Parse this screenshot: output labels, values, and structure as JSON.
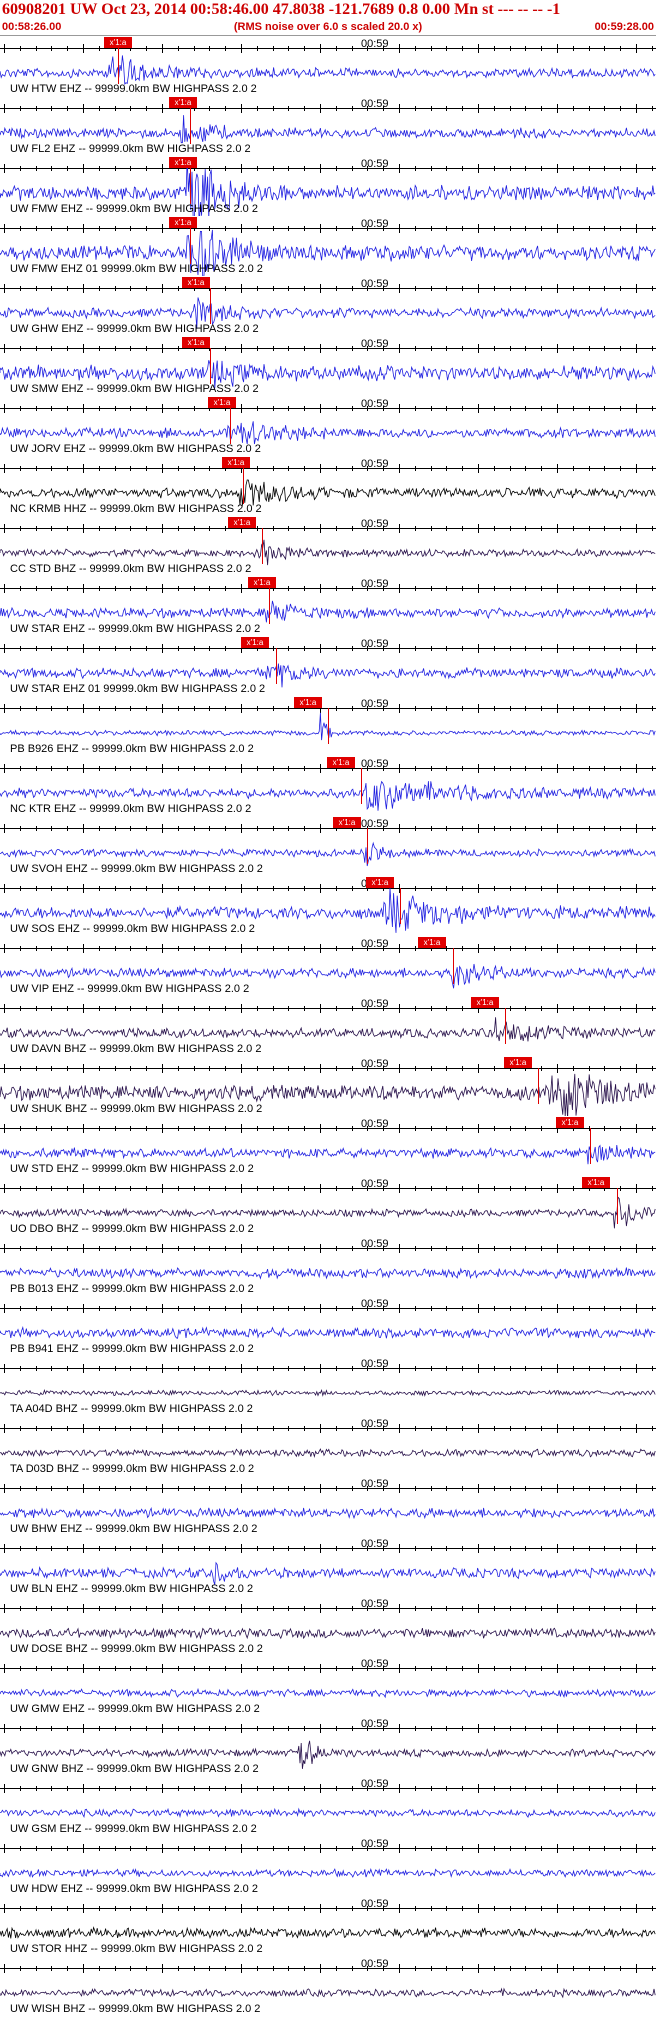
{
  "header": {
    "title": "60908201 UW Oct 23, 2014 00:58:46.00   47.8038 -121.7689  0.8 0.00 Mn st --- -- --  -1",
    "start_time": "00:58:26.00",
    "scale_note": "(RMS noise over 6.0 s scaled 20.0 x)",
    "end_time": "00:59:28.00"
  },
  "time_label": "00:59",
  "pick_label": "x'1:a",
  "colors": {
    "blue": "#1f1fe0",
    "black": "#000000",
    "navy": "#27104a",
    "pick": "#e00000",
    "title": "#cc0000"
  },
  "traces": [
    {
      "label": "UW HTW EHZ -- 99999.0km BW  HIGHPASS  2.0  2",
      "color": "blue",
      "amp": 4,
      "event": [
        0.17,
        0.06,
        12
      ],
      "pick": 0.17,
      "pick_end": 0.18
    },
    {
      "label": "UW FL2 EHZ -- 99999.0km BW  HIGHPASS  2.0  2",
      "color": "blue",
      "amp": 4,
      "event": [
        0.28,
        0.04,
        10
      ],
      "pick": 0.27,
      "pick_end": 0.29
    },
    {
      "label": "UW FMW EHZ -- 99999.0km BW  HIGHPASS  2.0  2",
      "color": "blue",
      "amp": 6,
      "event": [
        0.29,
        0.05,
        28
      ],
      "pick": 0.27,
      "pick_end": 0.29
    },
    {
      "label": "UW FMW EHZ 01 99999.0km BW  HIGHPASS  2.0  2",
      "color": "blue",
      "amp": 6,
      "event": [
        0.29,
        0.05,
        28
      ],
      "pick": 0.27,
      "pick_end": 0.29
    },
    {
      "label": "UW GHW EHZ -- 99999.0km BW  HIGHPASS  2.0  2",
      "color": "blue",
      "amp": 4,
      "event": [
        0.3,
        0.05,
        10
      ],
      "pick": 0.29,
      "pick_end": 0.32
    },
    {
      "label": "UW SMW EHZ -- 99999.0km BW  HIGHPASS  2.0  2",
      "color": "blue",
      "amp": 6,
      "event": [
        0.32,
        0.05,
        8
      ],
      "pick": 0.29,
      "pick_end": 0.32
    },
    {
      "label": "UW JORV EHZ -- 99999.0km BW  HIGHPASS  2.0  2",
      "color": "blue",
      "amp": 4,
      "event": [
        0.35,
        0.06,
        12
      ],
      "pick": 0.33,
      "pick_end": 0.35
    },
    {
      "label": "NC KRMB HHZ -- 99999.0km BW  HIGHPASS  2.0  2",
      "color": "black",
      "amp": 4,
      "event": [
        0.37,
        0.06,
        12
      ],
      "pick": 0.35,
      "pick_end": 0.37
    },
    {
      "label": "CC STD BHZ -- 99999.0km BW  HIGHPASS  2.0  2",
      "color": "navy",
      "amp": 3,
      "event": [
        0.4,
        0.04,
        8
      ],
      "pick": 0.36,
      "pick_end": 0.4
    },
    {
      "label": "UW STAR EHZ -- 99999.0km BW  HIGHPASS  2.0  2",
      "color": "blue",
      "amp": 4,
      "event": [
        0.41,
        0.04,
        10
      ],
      "pick": 0.39,
      "pick_end": 0.41
    },
    {
      "label": "UW STAR EHZ 01 99999.0km BW  HIGHPASS  2.0  2",
      "color": "blue",
      "amp": 4,
      "event": [
        0.41,
        0.04,
        10
      ],
      "pick": 0.38,
      "pick_end": 0.42
    },
    {
      "label": "PB B926 EHZ -- 99999.0km BW  HIGHPASS  2.0  2",
      "color": "blue",
      "amp": 2,
      "event": [
        0.49,
        0.01,
        20
      ],
      "pick": 0.46,
      "pick_end": 0.5
    },
    {
      "label": "NC KTR EHZ -- 99999.0km BW  HIGHPASS  2.0  2",
      "color": "blue",
      "amp": 4,
      "event": [
        0.56,
        0.1,
        14
      ],
      "pick": 0.51,
      "pick_end": 0.55
    },
    {
      "label": "UW SVOH EHZ -- 99999.0km BW  HIGHPASS  2.0  2",
      "color": "blue",
      "amp": 3,
      "event": [
        0.56,
        0.02,
        10
      ],
      "pick": 0.52,
      "pick_end": 0.56
    },
    {
      "label": "UW SOS EHZ -- 99999.0km BW  HIGHPASS  2.0  2",
      "color": "blue",
      "amp": 5,
      "event": [
        0.59,
        0.08,
        16
      ],
      "pick": 0.57,
      "pick_end": 0.61
    },
    {
      "label": "UW VIP EHZ -- 99999.0km BW  HIGHPASS  2.0  2",
      "color": "blue",
      "amp": 4,
      "event": [
        0.69,
        0.04,
        12
      ],
      "pick": 0.65,
      "pick_end": 0.69
    },
    {
      "label": "UW DAVN BHZ -- 99999.0km BW  HIGHPASS  2.0  2",
      "color": "navy",
      "amp": 4,
      "event": [
        0.76,
        0.06,
        10
      ],
      "pick": 0.73,
      "pick_end": 0.77
    },
    {
      "label": "UW SHUK BHZ -- 99999.0km BW  HIGHPASS  2.0  2",
      "color": "navy",
      "amp": 6,
      "event": [
        0.84,
        0.08,
        26
      ],
      "pick": 0.78,
      "pick_end": 0.82
    },
    {
      "label": "UW STD EHZ -- 99999.0km BW  HIGHPASS  2.0  2",
      "color": "blue",
      "amp": 4,
      "event": [
        0.9,
        0.04,
        8
      ],
      "pick": 0.86,
      "pick_end": 0.9
    },
    {
      "label": "UO DBO BHZ -- 99999.0km BW  HIGHPASS  2.0  2",
      "color": "navy",
      "amp": 3,
      "event": [
        0.94,
        0.04,
        12
      ],
      "pick": 0.9,
      "pick_end": 0.94
    },
    {
      "label": "PB B013 EHZ -- 99999.0km BW  HIGHPASS  2.0  2",
      "color": "blue",
      "amp": 4,
      "event": [
        0,
        0,
        0
      ]
    },
    {
      "label": "PB B941 EHZ -- 99999.0km BW  HIGHPASS  2.0  2",
      "color": "blue",
      "amp": 4,
      "event": [
        0,
        0,
        0
      ]
    },
    {
      "label": "TA A04D BHZ -- 99999.0km BW  HIGHPASS  2.0  2",
      "color": "navy",
      "amp": 2,
      "event": [
        0,
        0,
        0
      ]
    },
    {
      "label": "TA D03D BHZ -- 99999.0km BW  HIGHPASS  2.0  2",
      "color": "navy",
      "amp": 3,
      "event": [
        0,
        0,
        0
      ]
    },
    {
      "label": "UW BHW EHZ -- 99999.0km BW  HIGHPASS  2.0  2",
      "color": "blue",
      "amp": 4,
      "event": [
        0,
        0,
        0
      ]
    },
    {
      "label": "UW BLN EHZ -- 99999.0km BW  HIGHPASS  2.0  2",
      "color": "blue",
      "amp": 4,
      "event": [
        0.33,
        0.02,
        8
      ]
    },
    {
      "label": "UW DOSE BHZ -- 99999.0km BW  HIGHPASS  2.0  2",
      "color": "navy",
      "amp": 4,
      "event": [
        0,
        0,
        0
      ]
    },
    {
      "label": "UW GMW EHZ -- 99999.0km BW  HIGHPASS  2.0  2",
      "color": "blue",
      "amp": 3,
      "event": [
        0,
        0,
        0
      ]
    },
    {
      "label": "UW GNW BHZ -- 99999.0km BW  HIGHPASS  2.0  2",
      "color": "navy",
      "amp": 3,
      "event": [
        0.46,
        0.02,
        14
      ]
    },
    {
      "label": "UW GSM EHZ -- 99999.0km BW  HIGHPASS  2.0  2",
      "color": "blue",
      "amp": 3,
      "event": [
        0,
        0,
        0
      ]
    },
    {
      "label": "UW HDW EHZ -- 99999.0km BW  HIGHPASS  2.0  2",
      "color": "blue",
      "amp": 3,
      "event": [
        0,
        0,
        0
      ]
    },
    {
      "label": "UW STOR HHZ -- 99999.0km BW  HIGHPASS  2.0  2",
      "color": "black",
      "amp": 4,
      "event": [
        0,
        0,
        0
      ]
    },
    {
      "label": "UW WISH BHZ -- 99999.0km BW  HIGHPASS  2.0  2",
      "color": "navy",
      "amp": 3,
      "event": [
        0,
        0,
        0
      ]
    }
  ]
}
